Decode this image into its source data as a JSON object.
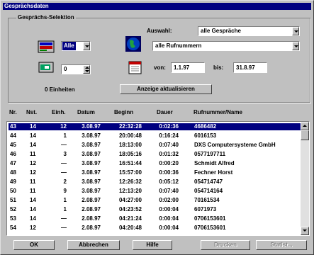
{
  "window": {
    "title": "Gesprächsdaten"
  },
  "selection": {
    "group_label": "Gesprächs-Selektion",
    "nst_combo_value": "Alle",
    "count_spin_value": "0",
    "units_text": "0 Einheiten",
    "auswahl_label": "Auswahl:",
    "auswahl_value": "alle Gespräche",
    "rufnummern_value": "alle Rufnummern",
    "von_label": "von:",
    "von_value": "1.1.97",
    "bis_label": "bis:",
    "bis_value": "31.8.97",
    "refresh_button": "Anzeige aktualisieren"
  },
  "table": {
    "columns": [
      "Nr.",
      "Nst.",
      "Einh.",
      "Datum",
      "Beginn",
      "Dauer",
      "Rufnummer/Name"
    ],
    "rows": [
      {
        "nr": "43",
        "nst": "14",
        "einh": "12",
        "datum": "3.08.97",
        "beginn": "22:32:28",
        "dauer": "0:02:36",
        "name": "4686482",
        "selected": true
      },
      {
        "nr": "44",
        "nst": "14",
        "einh": "1",
        "datum": "3.08.97",
        "beginn": "20:00:48",
        "dauer": "0:16:24",
        "name": "6016153",
        "selected": false
      },
      {
        "nr": "45",
        "nst": "14",
        "einh": "—",
        "datum": "3.08.97",
        "beginn": "18:13:00",
        "dauer": "0:07:40",
        "name": "DXS Computersysteme GmbH",
        "selected": false
      },
      {
        "nr": "46",
        "nst": "11",
        "einh": "3",
        "datum": "3.08.97",
        "beginn": "18:05:16",
        "dauer": "0:01:32",
        "name": "0577197711",
        "selected": false
      },
      {
        "nr": "47",
        "nst": "12",
        "einh": "—",
        "datum": "3.08.97",
        "beginn": "16:51:44",
        "dauer": "0:00:20",
        "name": "Schmidt Alfred",
        "selected": false
      },
      {
        "nr": "48",
        "nst": "12",
        "einh": "—",
        "datum": "3.08.97",
        "beginn": "15:57:00",
        "dauer": "0:00:36",
        "name": "Fechner Horst",
        "selected": false
      },
      {
        "nr": "49",
        "nst": "11",
        "einh": "2",
        "datum": "3.08.97",
        "beginn": "12:26:32",
        "dauer": "0:05:12",
        "name": "054714747",
        "selected": false
      },
      {
        "nr": "50",
        "nst": "11",
        "einh": "9",
        "datum": "3.08.97",
        "beginn": "12:13:20",
        "dauer": "0:07:40",
        "name": "054714164",
        "selected": false
      },
      {
        "nr": "51",
        "nst": "14",
        "einh": "1",
        "datum": "2.08.97",
        "beginn": "04:27:00",
        "dauer": "0:02:00",
        "name": "70161534",
        "selected": false
      },
      {
        "nr": "52",
        "nst": "14",
        "einh": "1",
        "datum": "2.08.97",
        "beginn": "04:23:52",
        "dauer": "0:00:04",
        "name": "6071973",
        "selected": false
      },
      {
        "nr": "53",
        "nst": "14",
        "einh": "—",
        "datum": "2.08.97",
        "beginn": "04:21:24",
        "dauer": "0:00:04",
        "name": "0706153601",
        "selected": false
      },
      {
        "nr": "54",
        "nst": "12",
        "einh": "—",
        "datum": "2.08.97",
        "beginn": "04:20:48",
        "dauer": "0:00:04",
        "name": "0706153601",
        "selected": false
      }
    ]
  },
  "buttons": {
    "ok": "OK",
    "cancel": "Abbrechen",
    "help": "Hilfe",
    "print": "Drucken",
    "statistics": "Statist..."
  }
}
